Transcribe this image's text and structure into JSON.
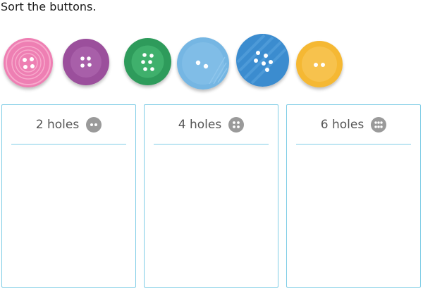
{
  "prompt": "Sort the buttons.",
  "buttons": [
    {
      "color": "#ee7fb3",
      "holes": 4,
      "name": "pink-button"
    },
    {
      "color": "#9b4f9c",
      "holes": 4,
      "name": "purple-button"
    },
    {
      "color": "#2e9b5b",
      "holes": 6,
      "name": "green-button"
    },
    {
      "color": "#75b6e3",
      "holes": 2,
      "name": "light-blue-button"
    },
    {
      "color": "#3b8ccf",
      "holes": 6,
      "name": "blue-button"
    },
    {
      "color": "#f5b833",
      "holes": 2,
      "name": "yellow-button"
    }
  ],
  "bins": [
    {
      "label": "2 holes",
      "icon": "two-hole-button-icon"
    },
    {
      "label": "4 holes",
      "icon": "four-hole-button-icon"
    },
    {
      "label": "6 holes",
      "icon": "six-hole-button-icon"
    }
  ],
  "colors": {
    "bin_border": "#7fcde6",
    "icon_gray": "#9a9a9a"
  }
}
